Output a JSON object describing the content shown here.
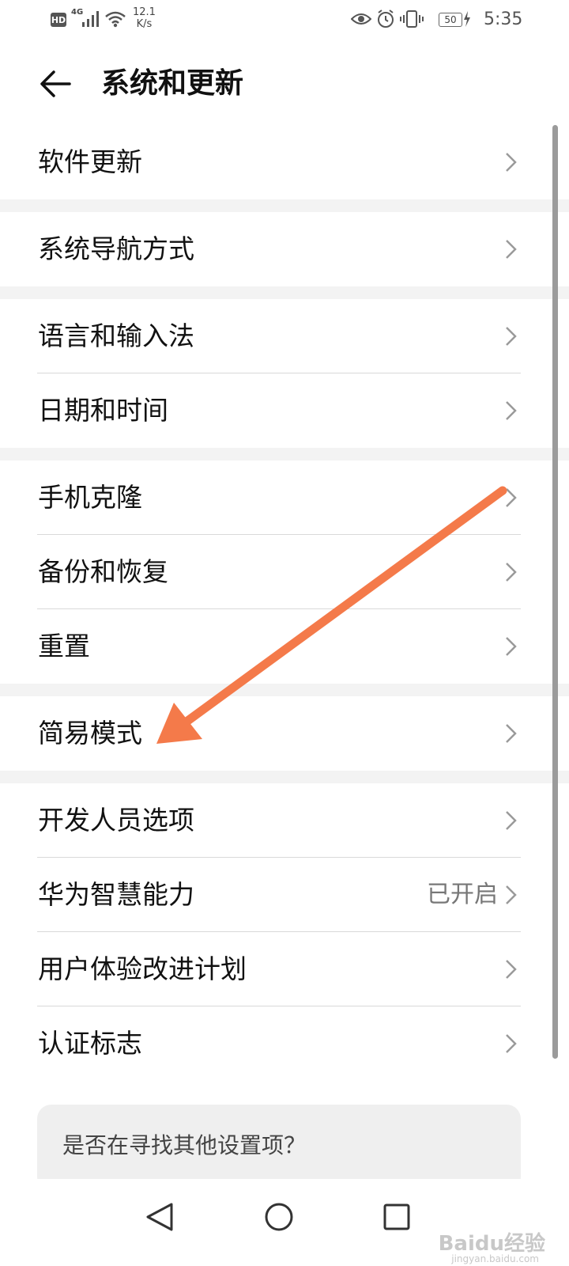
{
  "status_bar": {
    "network_badge": "HD",
    "network_type": "4G",
    "speed_value": "12.1",
    "speed_unit": "K/s",
    "battery": "50",
    "time": "5:35"
  },
  "header": {
    "title": "系统和更新"
  },
  "settings": [
    {
      "label": "软件更新",
      "value": ""
    },
    {
      "label": "系统导航方式",
      "value": ""
    },
    {
      "label": "语言和输入法",
      "value": ""
    },
    {
      "label": "日期和时间",
      "value": ""
    },
    {
      "label": "手机克隆",
      "value": ""
    },
    {
      "label": "备份和恢复",
      "value": ""
    },
    {
      "label": "重置",
      "value": ""
    },
    {
      "label": "简易模式",
      "value": ""
    },
    {
      "label": "开发人员选项",
      "value": ""
    },
    {
      "label": "华为智慧能力",
      "value": "已开启"
    },
    {
      "label": "用户体验改进计划",
      "value": ""
    },
    {
      "label": "认证标志",
      "value": ""
    }
  ],
  "search_card": {
    "text": "是否在寻找其他设置项？"
  },
  "watermark": {
    "brand": "Baidu经验",
    "url": "jingyan.baidu.com"
  },
  "colors": {
    "annotation_arrow": "#f47a4a",
    "section_gap": "#f3f3f3"
  }
}
